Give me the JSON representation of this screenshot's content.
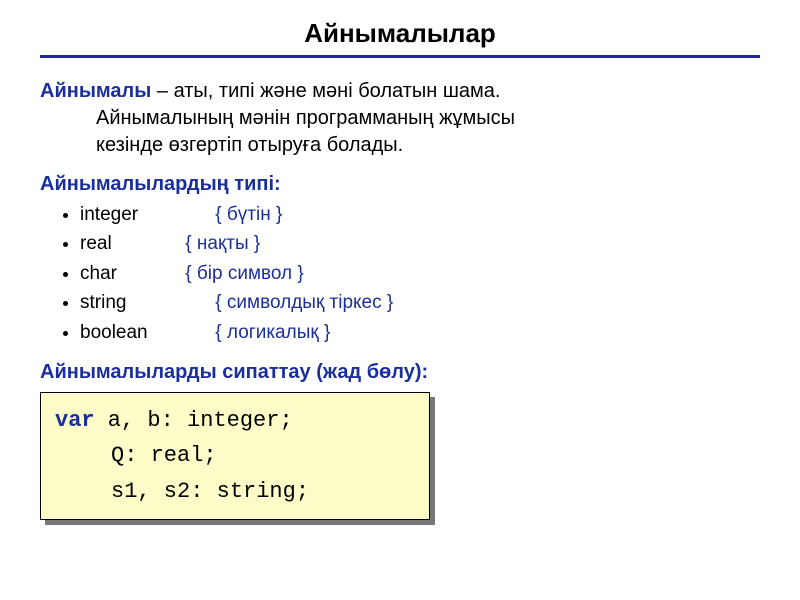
{
  "title": "Айнымалылар",
  "definition": {
    "term": "Айнымалы",
    "text1": " – аты, типі және мәні болатын шама.",
    "text2": "Айнымалының мәнін программаның жұмысы",
    "text3": "кезінде өзгертіп отыруға болады."
  },
  "types_heading": "Айнымалылардың типі:",
  "types": [
    {
      "name": "integer",
      "comment": "{ бүтін }",
      "narrow": false
    },
    {
      "name": "real",
      "comment": "{ нақты }",
      "narrow": true
    },
    {
      "name": "char",
      "comment": "{ бір символ }",
      "narrow": true
    },
    {
      "name": "string",
      "comment": "{ символдық тіркес }",
      "narrow": false
    },
    {
      "name": "boolean",
      "comment": "{ логикалық }",
      "narrow": false
    }
  ],
  "declare_heading": "Айнымалыларды сипаттау (жад бөлу):",
  "code": {
    "kw_var": "var",
    "line1_rest": " a, b: integer;",
    "line2": "Q: real;",
    "line3": "s1, s2: string;"
  }
}
